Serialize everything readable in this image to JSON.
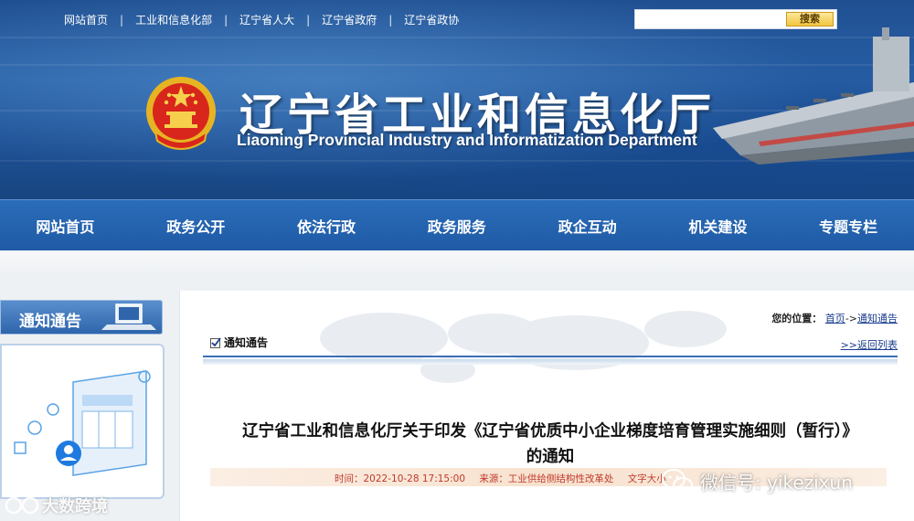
{
  "header": {
    "top_links": [
      "网站首页",
      "工业和信息化部",
      "辽宁省人大",
      "辽宁省政府",
      "辽宁省政协"
    ],
    "search_button": "搜索",
    "title_cn": "辽宁省工业和信息化厅",
    "title_en": "Liaoning Provincial Industry and Informatization Department"
  },
  "nav": {
    "items": [
      "网站首页",
      "政务公开",
      "依法行政",
      "政务服务",
      "政企互动",
      "机关建设",
      "专题专栏"
    ]
  },
  "sidebar": {
    "title": "通知通告"
  },
  "breadcrumb": {
    "label": "您的位置：",
    "home": "首页",
    "arrow": "->",
    "current": "通知通告"
  },
  "section": {
    "title": "通知通告",
    "back_link": ">>返回列表"
  },
  "article": {
    "title_line1": "辽宁省工业和信息化厅关于印发《辽宁省优质中小企业梯度培育管理实施细则（暂行）》",
    "title_line2": "的通知",
    "time": "时间：2022-10-28 17:15:00",
    "source": "来源：工业供给侧结构性改革处",
    "font_size": "文字大小"
  },
  "watermarks": {
    "left": "大数跨境",
    "right": "微信号: yikezixun"
  },
  "colors": {
    "nav_blue": "#1f5aa5",
    "meta_red": "#c0392b",
    "link_blue": "#1a3d8f"
  }
}
